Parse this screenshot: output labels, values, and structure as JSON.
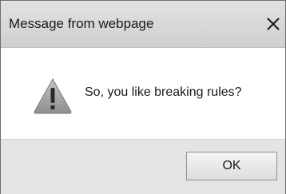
{
  "window": {
    "title": "Message from webpage",
    "close_icon": "close-icon",
    "close_glyph": "✕"
  },
  "content": {
    "icon": "warning-icon",
    "message": "So, you like breaking rules?"
  },
  "buttons": {
    "ok_label": "OK"
  },
  "colors": {
    "titlebar": "#d8d8d8",
    "footer": "#e4e4e4",
    "warning_triangle": "#a8a8a8"
  }
}
